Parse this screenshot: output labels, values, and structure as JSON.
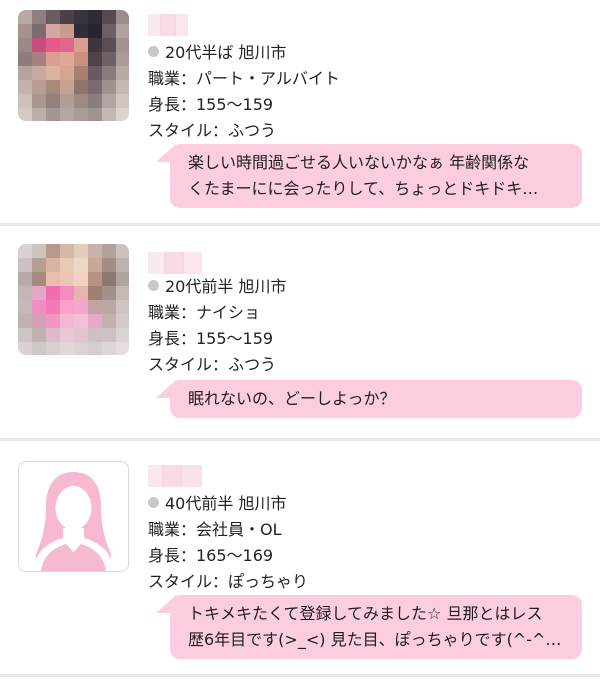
{
  "profiles": [
    {
      "age_area": "20代半ば 旭川市",
      "job": "職業：パート・アルバイト",
      "height": "身長：155〜159",
      "style": "スタイル：ふつう",
      "message_line1": "楽しい時間過ごせる人いないかなぁ 年齢関係な",
      "message_line2": "くたまーにに会ったりして、ちょっとドキドキ…",
      "avatar": "blurred-photo"
    },
    {
      "age_area": "20代前半 旭川市",
      "job": "職業：ナイショ",
      "height": "身長：155〜159",
      "style": "スタイル：ふつう",
      "message_line1": "眠れないの、どーしよっか？",
      "avatar": "blurred-photo"
    },
    {
      "age_area": "40代前半 旭川市",
      "job": "職業：会社員・OL",
      "height": "身長：165〜169",
      "style": "スタイル：ぽっちゃり",
      "message_line1": "トキメキたくて登録してみました☆ 旦那とはレス",
      "message_line2": "歴6年目です(>_<) 見た目、ぽっちゃりです(^-^…",
      "avatar": "female-silhouette-icon"
    }
  ],
  "colors": {
    "bubble": "#fccde0",
    "status_dot": "#c8c8c8",
    "divider": "#e8e8e8",
    "silhouette": "#f7b8d2"
  }
}
